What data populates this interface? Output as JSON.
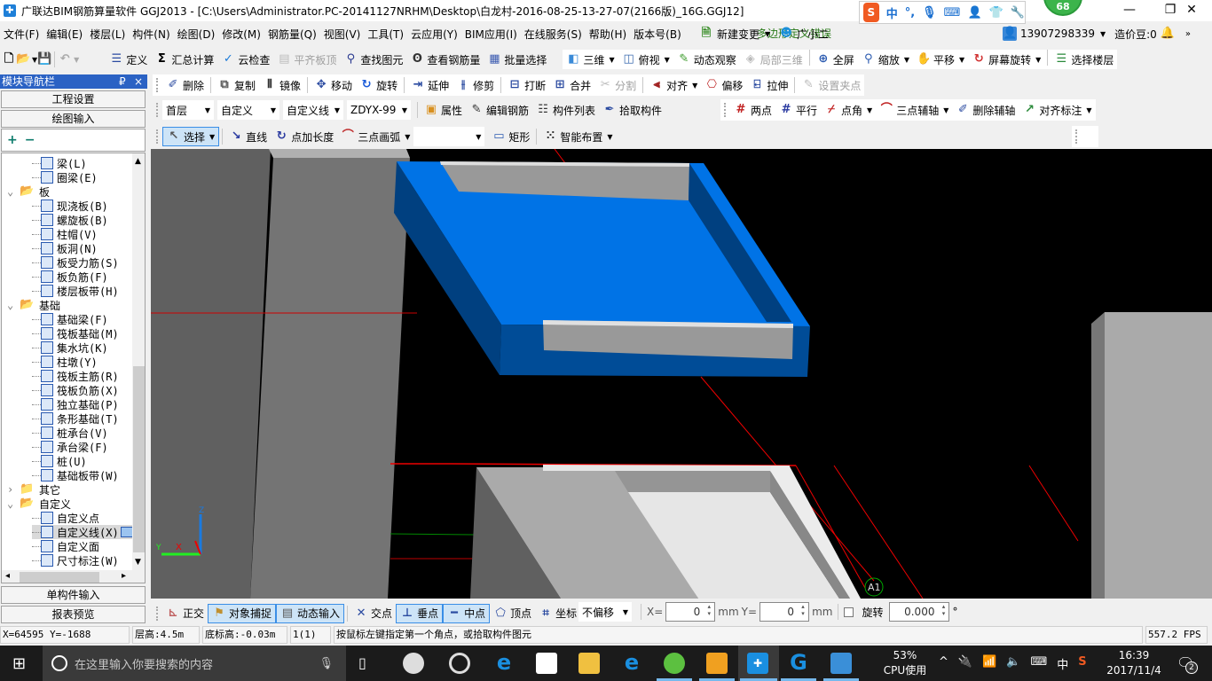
{
  "titlebar": {
    "title": "广联达BIM钢筋算量软件 GGJ2013 - [C:\\Users\\Administrator.PC-20141127NRHM\\Desktop\\白龙村-2016-08-25-13-27-07(2166版)_16G.GGJ12]",
    "badge": "68",
    "ime_mode": "中",
    "ime_punct": "°,",
    "minimize": "—",
    "restore": "❐",
    "close": "✕"
  },
  "menu": {
    "items": [
      "文件(F)",
      "编辑(E)",
      "楼层(L)",
      "构件(N)",
      "绘图(D)",
      "修改(M)",
      "钢筋量(Q)",
      "视图(V)",
      "工具(T)",
      "云应用(Y)",
      "BIM应用(I)",
      "在线服务(S)",
      "帮助(H)",
      "版本号(B)"
    ],
    "new_change": "新建变更",
    "assistant": "广小二",
    "message": "多边形定义错误",
    "phone": "13907298339",
    "beans": "造价豆:0",
    "more": "»"
  },
  "toolbar1": {
    "left": [
      {
        "label": "定义",
        "icon": "define-icon"
      },
      {
        "label": "汇总计算",
        "icon": "sigma-icon"
      },
      {
        "label": "云检查",
        "icon": "cloud-check-icon"
      },
      {
        "label": "平齐板顶",
        "icon": "align-slab-icon",
        "disabled": true
      },
      {
        "label": "查找图元",
        "icon": "binoculars-icon"
      },
      {
        "label": "查看钢筋量",
        "icon": "rebar-view-icon"
      },
      {
        "label": "批量选择",
        "icon": "batch-select-icon"
      }
    ],
    "right": [
      {
        "label": "三维",
        "icon": "cube-icon",
        "dropdown": true
      },
      {
        "label": "俯视",
        "icon": "top-view-icon",
        "dropdown": true
      },
      {
        "label": "动态观察",
        "icon": "orbit-icon"
      },
      {
        "label": "局部三维",
        "icon": "local-3d-icon",
        "disabled": true
      },
      {
        "label": "全屏",
        "icon": "fullscreen-icon"
      },
      {
        "label": "缩放",
        "icon": "zoom-icon",
        "dropdown": true
      },
      {
        "label": "平移",
        "icon": "pan-icon",
        "dropdown": true
      },
      {
        "label": "屏幕旋转",
        "icon": "screen-rotate-icon",
        "dropdown": true
      },
      {
        "label": "选择楼层",
        "icon": "floor-select-icon"
      }
    ]
  },
  "toolbar2": {
    "items": [
      {
        "label": "删除",
        "icon": "delete-icon"
      },
      {
        "label": "复制",
        "icon": "copy-icon"
      },
      {
        "label": "镜像",
        "icon": "mirror-icon"
      },
      {
        "label": "移动",
        "icon": "move-icon"
      },
      {
        "label": "旋转",
        "icon": "rotate-icon"
      },
      {
        "label": "延伸",
        "icon": "extend-icon"
      },
      {
        "label": "修剪",
        "icon": "trim-icon"
      },
      {
        "label": "打断",
        "icon": "break-icon"
      },
      {
        "label": "合并",
        "icon": "merge-icon"
      },
      {
        "label": "分割",
        "icon": "split-icon",
        "disabled": true
      },
      {
        "label": "对齐",
        "icon": "align-icon",
        "dropdown": true
      },
      {
        "label": "偏移",
        "icon": "offset-icon"
      },
      {
        "label": "拉伸",
        "icon": "stretch-icon"
      },
      {
        "label": "设置夹点",
        "icon": "grip-point-icon",
        "disabled": true
      }
    ]
  },
  "toolbar3": {
    "selects": [
      {
        "name": "floor-select",
        "value": "首层"
      },
      {
        "name": "category-select",
        "value": "自定义"
      },
      {
        "name": "type-select",
        "value": "自定义线"
      },
      {
        "name": "component-select",
        "value": "ZDYX-99"
      }
    ],
    "items": [
      {
        "label": "属性",
        "icon": "properties-icon"
      },
      {
        "label": "编辑钢筋",
        "icon": "edit-rebar-icon"
      },
      {
        "label": "构件列表",
        "icon": "component-list-icon"
      },
      {
        "label": "拾取构件",
        "icon": "eyedropper-icon"
      }
    ],
    "axis_items": [
      {
        "label": "两点",
        "icon": "two-point-axis-icon"
      },
      {
        "label": "平行",
        "icon": "parallel-axis-icon"
      },
      {
        "label": "点角",
        "icon": "point-angle-icon",
        "dropdown": true
      },
      {
        "label": "三点辅轴",
        "icon": "three-point-axis-icon",
        "dropdown": true
      },
      {
        "label": "删除辅轴",
        "icon": "delete-axis-icon"
      },
      {
        "label": "对齐标注",
        "icon": "align-dimension-icon",
        "dropdown": true
      }
    ]
  },
  "toolbar4": {
    "items": [
      {
        "label": "选择",
        "icon": "cursor-icon",
        "dropdown": true,
        "active": true
      },
      {
        "label": "直线",
        "icon": "line-icon"
      },
      {
        "label": "点加长度",
        "icon": "point-length-icon"
      },
      {
        "label": "三点画弧",
        "icon": "arc-icon",
        "dropdown": true
      }
    ],
    "blank_select": "",
    "items2": [
      {
        "label": "矩形",
        "icon": "rectangle-icon"
      },
      {
        "label": "智能布置",
        "icon": "smart-layout-icon",
        "dropdown": true
      }
    ]
  },
  "sidebar": {
    "header": "模块导航栏",
    "pin": "₽",
    "close": "×",
    "project_settings": "工程设置",
    "drawing_input": "绘图输入",
    "expand_all": "+",
    "collapse_all": "−",
    "tree": [
      {
        "label": "梁(L)",
        "level": 1,
        "icon": "beam-icon"
      },
      {
        "label": "圈梁(E)",
        "level": 1,
        "icon": "ring-beam-icon"
      },
      {
        "label": "板",
        "level": 0,
        "icon": "folder-open-icon",
        "expanded": true
      },
      {
        "label": "现浇板(B)",
        "level": 1,
        "icon": "cast-slab-icon"
      },
      {
        "label": "螺旋板(B)",
        "level": 1,
        "icon": "spiral-slab-icon"
      },
      {
        "label": "柱帽(V)",
        "level": 1,
        "icon": "column-cap-icon"
      },
      {
        "label": "板洞(N)",
        "level": 1,
        "icon": "slab-hole-icon"
      },
      {
        "label": "板受力筋(S)",
        "level": 1,
        "icon": "slab-rebar-icon"
      },
      {
        "label": "板负筋(F)",
        "level": 1,
        "icon": "slab-neg-rebar-icon"
      },
      {
        "label": "楼层板带(H)",
        "level": 1,
        "icon": "slab-strip-icon"
      },
      {
        "label": "基础",
        "level": 0,
        "icon": "folder-open-icon",
        "expanded": true
      },
      {
        "label": "基础梁(F)",
        "level": 1,
        "icon": "foundation-beam-icon"
      },
      {
        "label": "筏板基础(M)",
        "level": 1,
        "icon": "raft-icon"
      },
      {
        "label": "集水坑(K)",
        "level": 1,
        "icon": "sump-icon"
      },
      {
        "label": "柱墩(Y)",
        "level": 1,
        "icon": "pier-icon"
      },
      {
        "label": "筏板主筋(R)",
        "level": 1,
        "icon": "raft-main-rebar-icon"
      },
      {
        "label": "筏板负筋(X)",
        "level": 1,
        "icon": "raft-neg-rebar-icon"
      },
      {
        "label": "独立基础(P)",
        "level": 1,
        "icon": "isolated-footing-icon"
      },
      {
        "label": "条形基础(T)",
        "level": 1,
        "icon": "strip-footing-icon"
      },
      {
        "label": "桩承台(V)",
        "level": 1,
        "icon": "pile-cap-icon"
      },
      {
        "label": "承台梁(F)",
        "level": 1,
        "icon": "cap-beam-icon"
      },
      {
        "label": "桩(U)",
        "level": 1,
        "icon": "pile-icon"
      },
      {
        "label": "基础板带(W)",
        "level": 1,
        "icon": "foundation-strip-icon"
      },
      {
        "label": "其它",
        "level": 0,
        "icon": "folder-icon",
        "expanded": false
      },
      {
        "label": "自定义",
        "level": 0,
        "icon": "folder-open-icon",
        "expanded": true
      },
      {
        "label": "自定义点",
        "level": 1,
        "icon": "custom-point-icon"
      },
      {
        "label": "自定义线(X)",
        "level": 1,
        "icon": "custom-line-icon",
        "selected": true
      },
      {
        "label": "自定义面",
        "level": 1,
        "icon": "custom-face-icon"
      },
      {
        "label": "尺寸标注(W)",
        "level": 1,
        "icon": "dimension-icon"
      }
    ],
    "single_input": "单构件输入",
    "report_preview": "报表预览"
  },
  "viewport": {
    "grid_label": "A1",
    "axis_labels": {
      "x": "X",
      "y": "Y",
      "z": "Z"
    },
    "colors": {
      "slab_top": "#0073e6",
      "slab_side": "#004c97",
      "background": "#000000"
    }
  },
  "snapbar": {
    "items": [
      {
        "label": "正交",
        "icon": "ortho-icon"
      },
      {
        "label": "对象捕捉",
        "icon": "object-snap-icon",
        "active": true
      },
      {
        "label": "动态输入",
        "icon": "dynamic-input-icon",
        "active": true
      },
      {
        "label": "交点",
        "icon": "intersection-icon"
      },
      {
        "label": "垂点",
        "icon": "perpendicular-icon",
        "active": true
      },
      {
        "label": "中点",
        "icon": "midpoint-icon",
        "active": true
      },
      {
        "label": "顶点",
        "icon": "vertex-icon"
      },
      {
        "label": "坐标",
        "icon": "coordinate-icon"
      }
    ],
    "offset_mode": "不偏移",
    "x_label": "X=",
    "x_value": "0",
    "y_label": "Y=",
    "y_value": "0",
    "unit": "mm",
    "rotate_label": "旋转",
    "rotate_checked": false,
    "rotate_value": "0.000",
    "degree": "°"
  },
  "status": {
    "coords": "X=64595 Y=-1688",
    "floor_height": "层高:4.5m",
    "base_elevation": "底标高:-0.03m",
    "count": "1(1)",
    "hint": "按鼠标左键指定第一个角点，或拾取构件图元",
    "fps": "557.2 FPS"
  },
  "taskbar": {
    "search_placeholder": "在这里输入你要搜索的内容",
    "cpu_percent": "53%",
    "cpu_label": "CPU使用",
    "ime": "中",
    "time": "16:39",
    "date": "2017/11/4",
    "notifications": "2"
  }
}
